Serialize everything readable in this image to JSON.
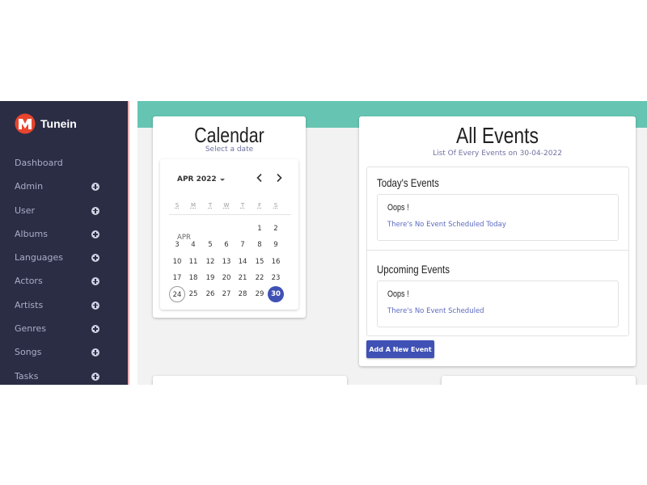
{
  "brand": {
    "name": "Tunein",
    "logo_colors": [
      "#e8452e",
      "#ffffff"
    ]
  },
  "sidebar": {
    "items": [
      {
        "label": "Dashboard",
        "expandable": false
      },
      {
        "label": "Admin",
        "expandable": true
      },
      {
        "label": "User",
        "expandable": true
      },
      {
        "label": "Albums",
        "expandable": true
      },
      {
        "label": "Languages",
        "expandable": true
      },
      {
        "label": "Actors",
        "expandable": true
      },
      {
        "label": "Artists",
        "expandable": true
      },
      {
        "label": "Genres",
        "expandable": true
      },
      {
        "label": "Songs",
        "expandable": true
      },
      {
        "label": "Tasks",
        "expandable": true
      }
    ]
  },
  "colors": {
    "sidebar": "#2b2d45",
    "accent_band": "#66c5b2",
    "primary": "#3f51b5"
  },
  "calendar": {
    "title": "Calendar",
    "subtitle": "Select a date",
    "month_button": "APR 2022",
    "month_label": "APR",
    "weekdays": [
      "S",
      "M",
      "T",
      "W",
      "T",
      "F",
      "S"
    ],
    "weeks": [
      [
        "",
        "",
        "",
        "",
        "",
        "1",
        "2"
      ],
      [
        "3",
        "4",
        "5",
        "6",
        "7",
        "8",
        "9"
      ],
      [
        "10",
        "11",
        "12",
        "13",
        "14",
        "15",
        "16"
      ],
      [
        "17",
        "18",
        "19",
        "20",
        "21",
        "22",
        "23"
      ],
      [
        "24",
        "25",
        "26",
        "27",
        "28",
        "29",
        "30"
      ]
    ],
    "today": "24",
    "selected": "30"
  },
  "events": {
    "title": "All Events",
    "subtitle": "List Of Every Events on 30-04-2022",
    "today": {
      "heading": "Today's Events",
      "message_title": "Oops !",
      "message_body": "There's No Event Scheduled Today"
    },
    "upcoming": {
      "heading": "Upcoming Events",
      "message_title": "Oops !",
      "message_body": "There's No Event Scheduled"
    },
    "add_button": "Add A New Event"
  }
}
